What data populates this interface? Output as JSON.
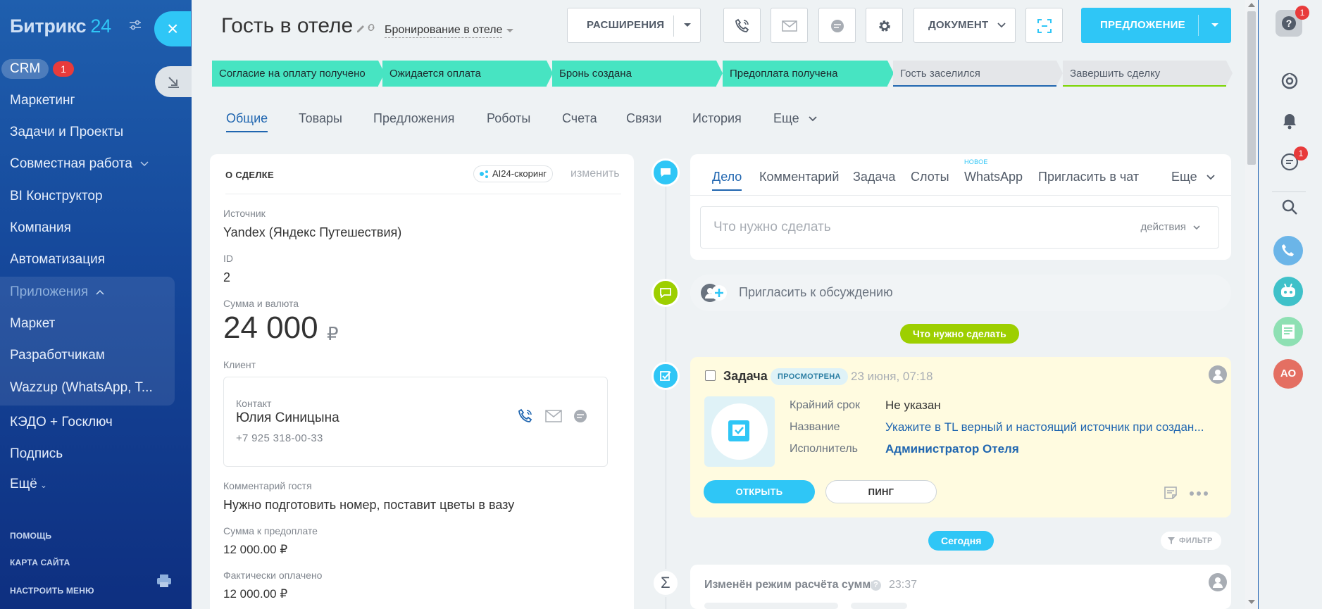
{
  "sidebar": {
    "logo": "Битрикс",
    "logo_number": "24",
    "crm_label": "CRM",
    "crm_badge": "1",
    "items": [
      "Маркетинг",
      "Задачи и Проекты",
      "Совместная работа",
      "BI Конструктор",
      "Компания",
      "Автоматизация",
      "Приложения",
      "Маркет",
      "Разработчикам",
      "Wazzup (WhatsApp, T...",
      "КЭДО + Госключ",
      "Подпись",
      "Ещё"
    ],
    "footer": [
      "ПОМОЩЬ",
      "КАРТА САЙТА",
      "НАСТРОИТЬ МЕНЮ"
    ]
  },
  "header": {
    "title": "Гость в отеле",
    "pipeline": "Бронирование в отеле",
    "btn_extensions": "РАСШИРЕНИЯ",
    "btn_document": "ДОКУМЕНТ",
    "btn_offer": "ПРЕДЛОЖЕНИЕ"
  },
  "stages": [
    {
      "label": "Согласие на оплату получено",
      "status": "done"
    },
    {
      "label": "Ожидается оплата",
      "status": "done"
    },
    {
      "label": "Бронь создана",
      "status": "done"
    },
    {
      "label": "Предоплата получена",
      "status": "done"
    },
    {
      "label": "Гость заселился",
      "status": "todo"
    },
    {
      "label": "Завершить сделку",
      "status": "todo"
    }
  ],
  "tabs": [
    "Общие",
    "Товары",
    "Предложения",
    "Роботы",
    "Счета",
    "Связи",
    "История",
    "Еще"
  ],
  "deal": {
    "section_title": "О СДЕЛКЕ",
    "ai_badge": "AI24-скоринг",
    "change_link": "изменить",
    "source_label": "Источник",
    "source_value": "Yandex (Яндекс Путешествия)",
    "id_label": "ID",
    "id_value": "2",
    "sum_label": "Сумма и валюта",
    "sum_value": "24 000",
    "sum_currency": "₽",
    "client_label": "Клиент",
    "contact_label": "Контакт",
    "contact_name": "Юлия Синицына",
    "contact_phone": "+7 925 318-00-33",
    "comment_label": "Комментарий гостя",
    "comment_value": "Нужно подготовить номер, поставит цветы в вазу",
    "prepay_label": "Сумма к предоплате",
    "prepay_value": "12 000.00 ₽",
    "paid_label": "Фактически оплачено",
    "paid_value": "12 000.00 ₽"
  },
  "compose": {
    "tabs": [
      "Дело",
      "Комментарий",
      "Задача",
      "Слоты",
      "WhatsApp",
      "Пригласить в чат",
      "Еще"
    ],
    "new_badge": "НОВОЕ",
    "placeholder": "Что нужно сделать",
    "actions": "действия"
  },
  "invite": "Пригласить к обсуждению",
  "todo_pill": "Что нужно сделать",
  "task": {
    "title": "Задача",
    "badge": "ПРОСМОТРЕНА",
    "time": "23 июня, 07:18",
    "deadline_label": "Крайний срок",
    "deadline_value": "Не указан",
    "name_label": "Название",
    "name_value": "Укажите в TL верный и настоящий источник при создан...",
    "executor_label": "Исполнитель",
    "executor_value": "Администратор Отеля",
    "btn_open": "ОТКРЫТЬ",
    "btn_ping": "ПИНГ"
  },
  "today_pill": "Сегодня",
  "filter": "ФИЛЬТР",
  "history": {
    "title": "Изменён режим расчёта суммы",
    "help": "?",
    "time": "23:37"
  },
  "rail": {
    "help_badge": "1",
    "chat_badge": "1",
    "avatar_initials": "АО"
  },
  "colors": {
    "accent": "#2fc6f6",
    "stage_done": "#47e4c2",
    "link": "#2066b0",
    "green": "#9dcf00",
    "badge_red": "#e83b3b"
  }
}
